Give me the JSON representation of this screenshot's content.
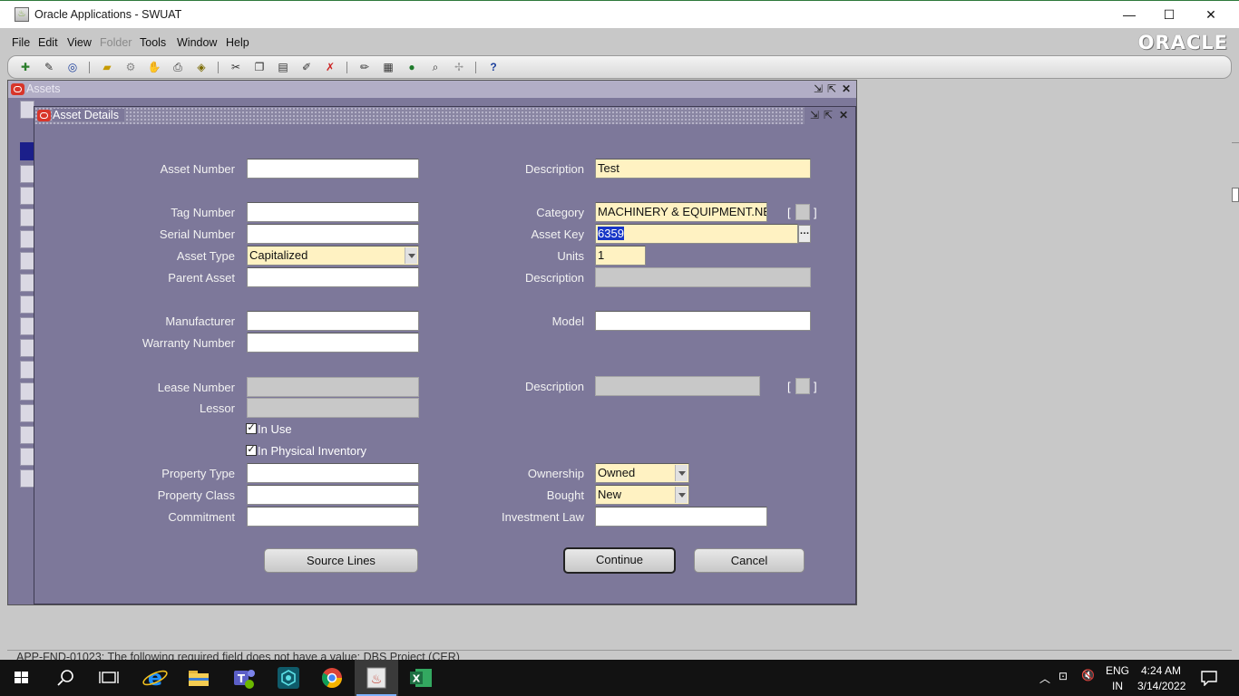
{
  "window": {
    "title": "Oracle Applications - SWUAT",
    "icon": "java-icon"
  },
  "menu": {
    "items": [
      {
        "label": "File",
        "disabled": false
      },
      {
        "label": "Edit",
        "disabled": false
      },
      {
        "label": "View",
        "disabled": false
      },
      {
        "label": "Folder",
        "disabled": true
      },
      {
        "label": "Tools",
        "disabled": false
      },
      {
        "label": "Window",
        "disabled": false
      },
      {
        "label": "Help",
        "disabled": false
      }
    ],
    "logo": "ORACLE"
  },
  "assets_window": {
    "title": "Assets"
  },
  "dialog": {
    "title": "Asset Details",
    "labels": {
      "asset_number": "Asset Number",
      "tag_number": "Tag Number",
      "serial_number": "Serial Number",
      "asset_type": "Asset Type",
      "parent_asset": "Parent Asset",
      "manufacturer": "Manufacturer",
      "warranty_number": "Warranty Number",
      "lease_number": "Lease Number",
      "lessor": "Lessor",
      "property_type": "Property Type",
      "property_class": "Property Class",
      "commitment": "Commitment",
      "description": "Description",
      "category": "Category",
      "asset_key": "Asset Key",
      "units": "Units",
      "description2": "Description",
      "model": "Model",
      "lease_description": "Description",
      "ownership": "Ownership",
      "bought": "Bought",
      "investment_law": "Investment Law"
    },
    "values": {
      "asset_number": "",
      "tag_number": "",
      "serial_number": "",
      "asset_type": "Capitalized",
      "parent_asset": "",
      "manufacturer": "",
      "warranty_number": "",
      "lease_number": "",
      "lessor": "",
      "property_type": "",
      "property_class": "",
      "commitment": "",
      "description": "Test",
      "category": "MACHINERY & EQUIPMENT.NE",
      "asset_key": "6359",
      "units": "1",
      "description2": "",
      "model": "",
      "lease_description": "",
      "ownership": "Owned",
      "bought": "New",
      "investment_law": ""
    },
    "checkboxes": {
      "in_use": {
        "label": "In Use",
        "checked": true
      },
      "in_physical_inventory": {
        "label": "In Physical Inventory",
        "checked": true
      }
    },
    "buttons": {
      "source_lines": "Source Lines",
      "continue": "Continue",
      "cancel": "Cancel"
    },
    "bracket_open": "[",
    "bracket_close": "]",
    "lov_glyph": "…",
    "check_glyph": "✓"
  },
  "status": {
    "message": "APP-FND-01023: The following required field does not have a value: DBS Project (CER)"
  },
  "taskbar": {
    "language": "ENG",
    "region": "IN",
    "time": "4:24 AM",
    "date": "3/14/2022"
  },
  "colors": {
    "form_background": "#7d789a",
    "required_field": "#fff2c2",
    "readonly_field": "#c8c8c8",
    "oracle_red": "#d8352a"
  }
}
